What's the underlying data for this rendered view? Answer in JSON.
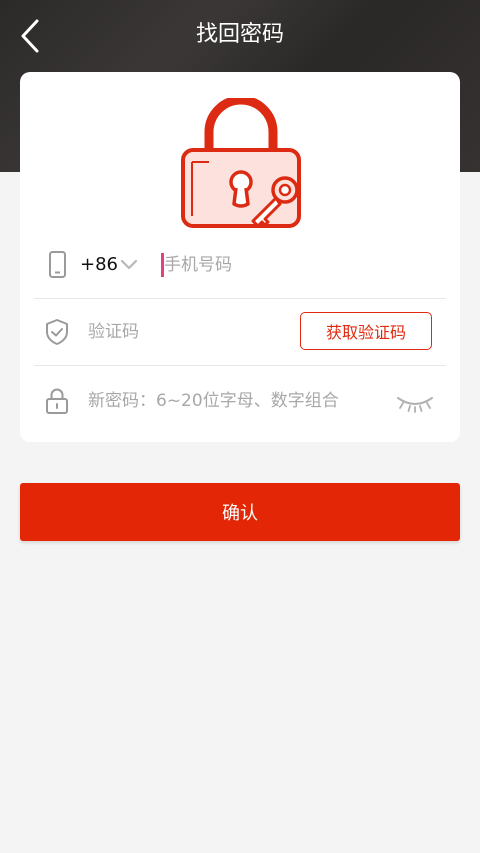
{
  "header": {
    "title": "找回密码",
    "back_icon": "chevron-left-icon"
  },
  "card": {
    "illustration": "lock-with-key-icon",
    "phone_row": {
      "icon": "phone-icon",
      "country_code": "+86",
      "country_chevron_icon": "chevron-down-icon",
      "placeholder": "手机号码",
      "value": ""
    },
    "code_row": {
      "icon": "shield-check-icon",
      "placeholder": "验证码",
      "value": "",
      "get_code_label": "获取验证码"
    },
    "password_row": {
      "icon": "lock-icon",
      "placeholder": "新密码：6~20位字母、数字组合",
      "value": "",
      "visibility_icon": "eye-closed-icon"
    }
  },
  "confirm": {
    "label": "确认"
  },
  "colors": {
    "accent": "#e22606",
    "header_bg": "#2e2c2b",
    "page_bg": "#f4f4f4",
    "cursor": "#e2407e"
  }
}
